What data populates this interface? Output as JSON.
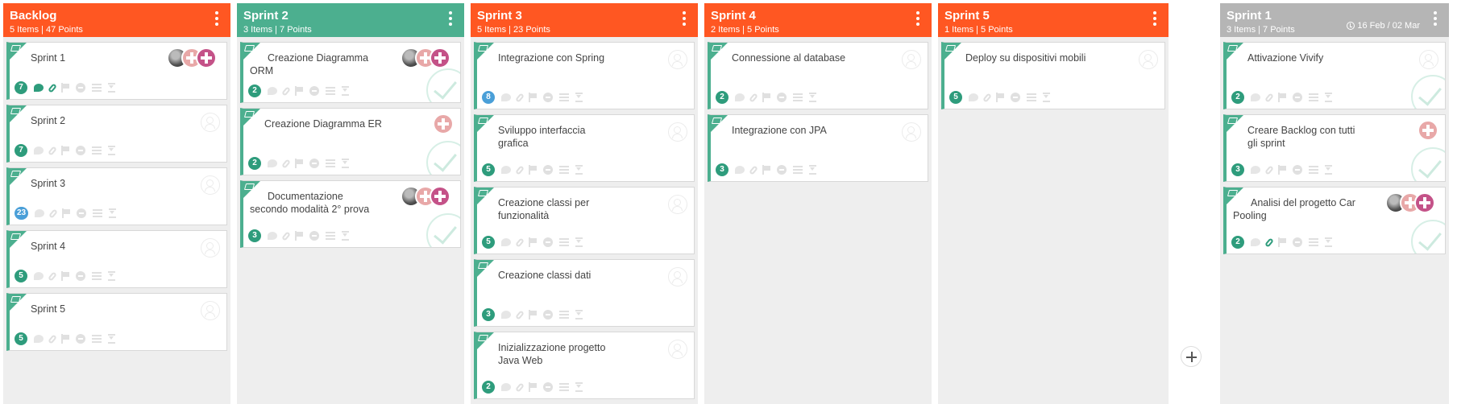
{
  "colors": {
    "orange": "#ff5722",
    "green": "#4caf8f",
    "grey": "#b5b5b5",
    "accent": "#2e9c7c",
    "blue_badge": "#4a9fd8"
  },
  "columns": [
    {
      "title": "Backlog",
      "meta": "5 Items | 47 Points",
      "color": "orange",
      "cards": [
        {
          "title": "Sprint 1",
          "points": "7"
        },
        {
          "title": "Sprint 2",
          "points": "7"
        },
        {
          "title": "Sprint 3",
          "points": "23"
        },
        {
          "title": "Sprint 4",
          "points": "5"
        },
        {
          "title": "Sprint 5",
          "points": "5"
        }
      ]
    },
    {
      "title": "Sprint 2",
      "meta": "3 Items | 7 Points",
      "color": "green",
      "cards": [
        {
          "title": "Creazione Diagramma ORM",
          "points": "2"
        },
        {
          "title": "Creazione Diagramma ER",
          "points": "2"
        },
        {
          "title": "Documentazione secondo modalità 2° prova",
          "points": "3"
        }
      ]
    },
    {
      "title": "Sprint 3",
      "meta": "5 Items | 23 Points",
      "color": "orange",
      "cards": [
        {
          "title": "Integrazione con Spring",
          "points": "8"
        },
        {
          "title": "Sviluppo interfaccia grafica",
          "points": "5"
        },
        {
          "title": "Creazione classi per funzionalità",
          "points": "5"
        },
        {
          "title": "Creazione classi dati",
          "points": "3"
        },
        {
          "title": "Inizializzazione progetto Java Web",
          "points": "2"
        }
      ]
    },
    {
      "title": "Sprint 4",
      "meta": "2 Items | 5 Points",
      "color": "orange",
      "cards": [
        {
          "title": "Connessione al database",
          "points": "2"
        },
        {
          "title": "Integrazione con JPA",
          "points": "3"
        }
      ]
    },
    {
      "title": "Sprint 5",
      "meta": "1 Items | 5 Points",
      "color": "orange",
      "cards": [
        {
          "title": "Deploy su dispositivi mobili",
          "points": "5"
        }
      ]
    },
    {
      "title": "Sprint 1",
      "meta": "3 Items | 7 Points",
      "dates": "16 Feb / 02 Mar",
      "color": "grey",
      "cards": [
        {
          "title": "Attivazione Vivify",
          "points": "2"
        },
        {
          "title": "Creare Backlog con tutti gli sprint",
          "points": "3"
        },
        {
          "title": "Analisi del progetto Car Pooling",
          "points": "2"
        }
      ]
    }
  ],
  "icons": {
    "column_menu": "more-vertical-icon",
    "add_column": "plus-icon",
    "card_type": "story-icon",
    "comment": "comment-icon",
    "attachment": "paperclip-icon",
    "flag": "flag-icon",
    "blocked": "block-icon",
    "checklist": "list-icon",
    "time": "hourglass-icon",
    "assign": "add-user-icon",
    "done": "check-circle-icon",
    "dates": "clock-icon"
  }
}
